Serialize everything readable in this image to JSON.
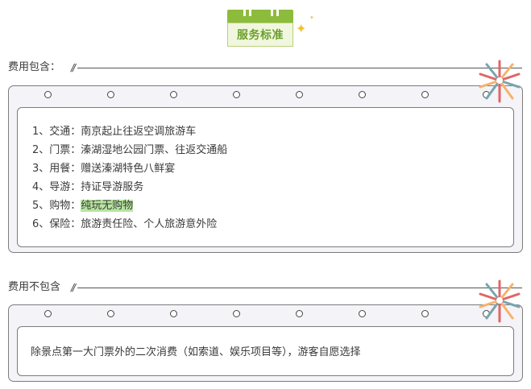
{
  "header": {
    "title": "服务标准"
  },
  "included": {
    "label": "费用包含：",
    "items": [
      {
        "prefix": "1、交通：",
        "text": "南京起止往返空调旅游车",
        "highlight": false
      },
      {
        "prefix": "2、门票：",
        "text": "溱湖湿地公园门票、往返交通船",
        "highlight": false
      },
      {
        "prefix": "3、用餐：",
        "text": "赠送溱湖特色八鲜宴",
        "highlight": false
      },
      {
        "prefix": "4、导游：",
        "text": "持证导游服务",
        "highlight": false
      },
      {
        "prefix": "5、购物：",
        "text": "纯玩无购物",
        "highlight": true
      },
      {
        "prefix": "6、保险：",
        "text": "旅游责任险、个人旅游意外险",
        "highlight": false
      }
    ]
  },
  "excluded": {
    "label": "费用不包含",
    "note": "除景点第一大门票外的二次消费（如索道、娱乐项目等），游客自愿选择"
  },
  "colors": {
    "badge_green": "#8dbb3c",
    "highlight": "#b7e5a0",
    "card_bg": "#f4f3f8"
  },
  "icons": [
    "calendar-badge-icon",
    "sparkle-icon",
    "firework-icon",
    "binder-hole-icon"
  ]
}
